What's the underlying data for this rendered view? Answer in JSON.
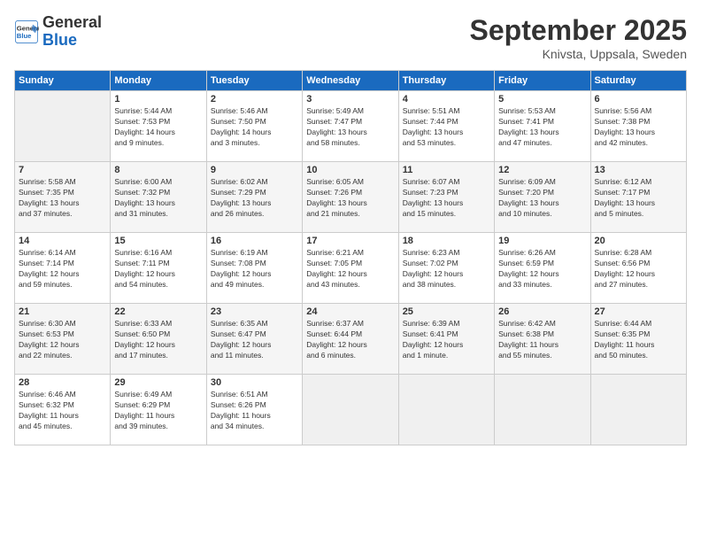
{
  "logo": {
    "line1": "General",
    "line2": "Blue"
  },
  "title": "September 2025",
  "location": "Knivsta, Uppsala, Sweden",
  "days_of_week": [
    "Sunday",
    "Monday",
    "Tuesday",
    "Wednesday",
    "Thursday",
    "Friday",
    "Saturday"
  ],
  "weeks": [
    [
      {
        "day": "",
        "info": ""
      },
      {
        "day": "1",
        "info": "Sunrise: 5:44 AM\nSunset: 7:53 PM\nDaylight: 14 hours\nand 9 minutes."
      },
      {
        "day": "2",
        "info": "Sunrise: 5:46 AM\nSunset: 7:50 PM\nDaylight: 14 hours\nand 3 minutes."
      },
      {
        "day": "3",
        "info": "Sunrise: 5:49 AM\nSunset: 7:47 PM\nDaylight: 13 hours\nand 58 minutes."
      },
      {
        "day": "4",
        "info": "Sunrise: 5:51 AM\nSunset: 7:44 PM\nDaylight: 13 hours\nand 53 minutes."
      },
      {
        "day": "5",
        "info": "Sunrise: 5:53 AM\nSunset: 7:41 PM\nDaylight: 13 hours\nand 47 minutes."
      },
      {
        "day": "6",
        "info": "Sunrise: 5:56 AM\nSunset: 7:38 PM\nDaylight: 13 hours\nand 42 minutes."
      }
    ],
    [
      {
        "day": "7",
        "info": "Sunrise: 5:58 AM\nSunset: 7:35 PM\nDaylight: 13 hours\nand 37 minutes."
      },
      {
        "day": "8",
        "info": "Sunrise: 6:00 AM\nSunset: 7:32 PM\nDaylight: 13 hours\nand 31 minutes."
      },
      {
        "day": "9",
        "info": "Sunrise: 6:02 AM\nSunset: 7:29 PM\nDaylight: 13 hours\nand 26 minutes."
      },
      {
        "day": "10",
        "info": "Sunrise: 6:05 AM\nSunset: 7:26 PM\nDaylight: 13 hours\nand 21 minutes."
      },
      {
        "day": "11",
        "info": "Sunrise: 6:07 AM\nSunset: 7:23 PM\nDaylight: 13 hours\nand 15 minutes."
      },
      {
        "day": "12",
        "info": "Sunrise: 6:09 AM\nSunset: 7:20 PM\nDaylight: 13 hours\nand 10 minutes."
      },
      {
        "day": "13",
        "info": "Sunrise: 6:12 AM\nSunset: 7:17 PM\nDaylight: 13 hours\nand 5 minutes."
      }
    ],
    [
      {
        "day": "14",
        "info": "Sunrise: 6:14 AM\nSunset: 7:14 PM\nDaylight: 12 hours\nand 59 minutes."
      },
      {
        "day": "15",
        "info": "Sunrise: 6:16 AM\nSunset: 7:11 PM\nDaylight: 12 hours\nand 54 minutes."
      },
      {
        "day": "16",
        "info": "Sunrise: 6:19 AM\nSunset: 7:08 PM\nDaylight: 12 hours\nand 49 minutes."
      },
      {
        "day": "17",
        "info": "Sunrise: 6:21 AM\nSunset: 7:05 PM\nDaylight: 12 hours\nand 43 minutes."
      },
      {
        "day": "18",
        "info": "Sunrise: 6:23 AM\nSunset: 7:02 PM\nDaylight: 12 hours\nand 38 minutes."
      },
      {
        "day": "19",
        "info": "Sunrise: 6:26 AM\nSunset: 6:59 PM\nDaylight: 12 hours\nand 33 minutes."
      },
      {
        "day": "20",
        "info": "Sunrise: 6:28 AM\nSunset: 6:56 PM\nDaylight: 12 hours\nand 27 minutes."
      }
    ],
    [
      {
        "day": "21",
        "info": "Sunrise: 6:30 AM\nSunset: 6:53 PM\nDaylight: 12 hours\nand 22 minutes."
      },
      {
        "day": "22",
        "info": "Sunrise: 6:33 AM\nSunset: 6:50 PM\nDaylight: 12 hours\nand 17 minutes."
      },
      {
        "day": "23",
        "info": "Sunrise: 6:35 AM\nSunset: 6:47 PM\nDaylight: 12 hours\nand 11 minutes."
      },
      {
        "day": "24",
        "info": "Sunrise: 6:37 AM\nSunset: 6:44 PM\nDaylight: 12 hours\nand 6 minutes."
      },
      {
        "day": "25",
        "info": "Sunrise: 6:39 AM\nSunset: 6:41 PM\nDaylight: 12 hours\nand 1 minute."
      },
      {
        "day": "26",
        "info": "Sunrise: 6:42 AM\nSunset: 6:38 PM\nDaylight: 11 hours\nand 55 minutes."
      },
      {
        "day": "27",
        "info": "Sunrise: 6:44 AM\nSunset: 6:35 PM\nDaylight: 11 hours\nand 50 minutes."
      }
    ],
    [
      {
        "day": "28",
        "info": "Sunrise: 6:46 AM\nSunset: 6:32 PM\nDaylight: 11 hours\nand 45 minutes."
      },
      {
        "day": "29",
        "info": "Sunrise: 6:49 AM\nSunset: 6:29 PM\nDaylight: 11 hours\nand 39 minutes."
      },
      {
        "day": "30",
        "info": "Sunrise: 6:51 AM\nSunset: 6:26 PM\nDaylight: 11 hours\nand 34 minutes."
      },
      {
        "day": "",
        "info": ""
      },
      {
        "day": "",
        "info": ""
      },
      {
        "day": "",
        "info": ""
      },
      {
        "day": "",
        "info": ""
      }
    ]
  ]
}
